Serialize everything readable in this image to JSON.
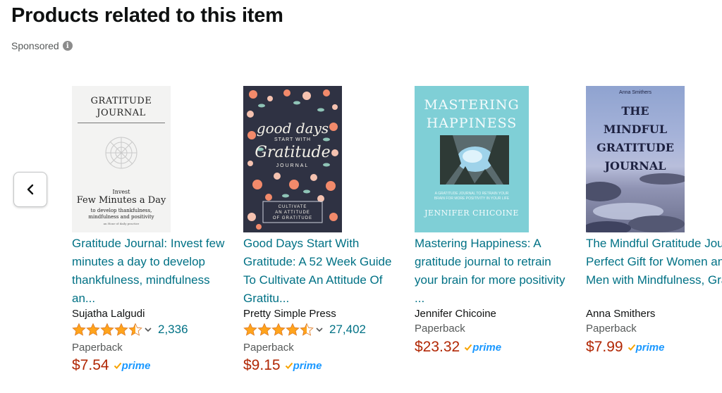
{
  "heading": "Products related to this item",
  "sponsored": "Sponsored",
  "colors": {
    "link": "#007185",
    "price": "#b12704",
    "star": "#ffa41c",
    "prime": "#1a98ff"
  },
  "products": [
    {
      "title": "Gratitude Journal: Invest few minutes a day to develop thankfulness, mindfulness an...",
      "author": "Sujatha Lalgudi",
      "rating": 4.5,
      "review_count": "2,336",
      "format": "Paperback",
      "price": "$7.54",
      "prime": "prime",
      "cover": {
        "title_line1": "GRATITUDE",
        "title_line2": "JOURNAL",
        "line3": "Invest",
        "line4": "Few Minutes a Day",
        "line5": "to develop thankfulness,",
        "line6": "mindfulness and positivity",
        "line7": "an Hour of daily practice"
      }
    },
    {
      "title": "Good Days Start With Gratitude: A 52 Week Guide To Cultivate An Attitude Of Gratitu...",
      "author": "Pretty Simple Press",
      "rating": 4.5,
      "review_count": "27,402",
      "format": "Paperback",
      "price": "$9.15",
      "prime": "prime",
      "cover": {
        "line1": "good days",
        "line2": "START WITH",
        "line3": "Gratitude",
        "line4": "JOURNAL",
        "line5": "CULTIVATE",
        "line6": "AN ATTITUDE",
        "line7": "OF GRATITUDE"
      }
    },
    {
      "title": "Mastering Happiness: A gratitude journal to retrain your brain for more positivity ...",
      "author": "Jennifer Chicoine",
      "format": "Paperback",
      "price": "$23.32",
      "prime": "prime",
      "cover": {
        "line1": "MASTERING",
        "line2": "HAPPINESS",
        "line3": "A GRATITUDE JOURNAL TO RETRAIN YOUR",
        "line4": "BRAIN FOR MORE POSITIVITY IN YOUR LIFE",
        "author": "JENNIFER CHICOINE"
      }
    },
    {
      "title": "The Mindful Gratitude Journal: Perfect Gift for Women and Men with Mindfulness, Gra...",
      "author": "Anna Smithers",
      "format": "Paperback",
      "price": "$7.99",
      "prime": "prime",
      "cover": {
        "author": "Anna Smithers",
        "line1": "THE",
        "line2": "MINDFUL",
        "line3": "GRATITUDE",
        "line4": "JOURNAL"
      }
    }
  ]
}
